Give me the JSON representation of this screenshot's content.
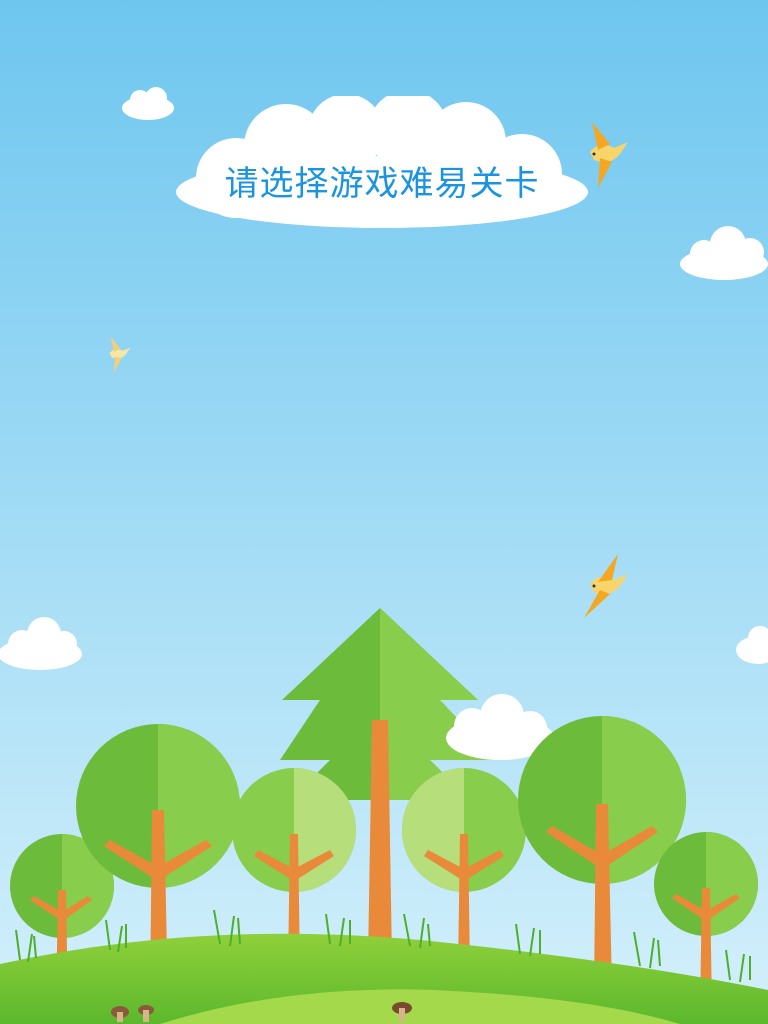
{
  "title": "请选择游戏难易关卡",
  "colors": {
    "sky_top": "#6ec6ef",
    "sky_bottom": "#cfeefb",
    "cloud": "#ffffff",
    "title_text": "#1a94e0",
    "grass_light": "#8ccf3a",
    "grass_dark": "#4fae2a",
    "trunk": "#e98a3b",
    "bird": "#f5a623"
  },
  "icons": [
    "cloud-icon",
    "bird-icon",
    "tree-icon",
    "pine-tree-icon",
    "mushroom-icon"
  ]
}
